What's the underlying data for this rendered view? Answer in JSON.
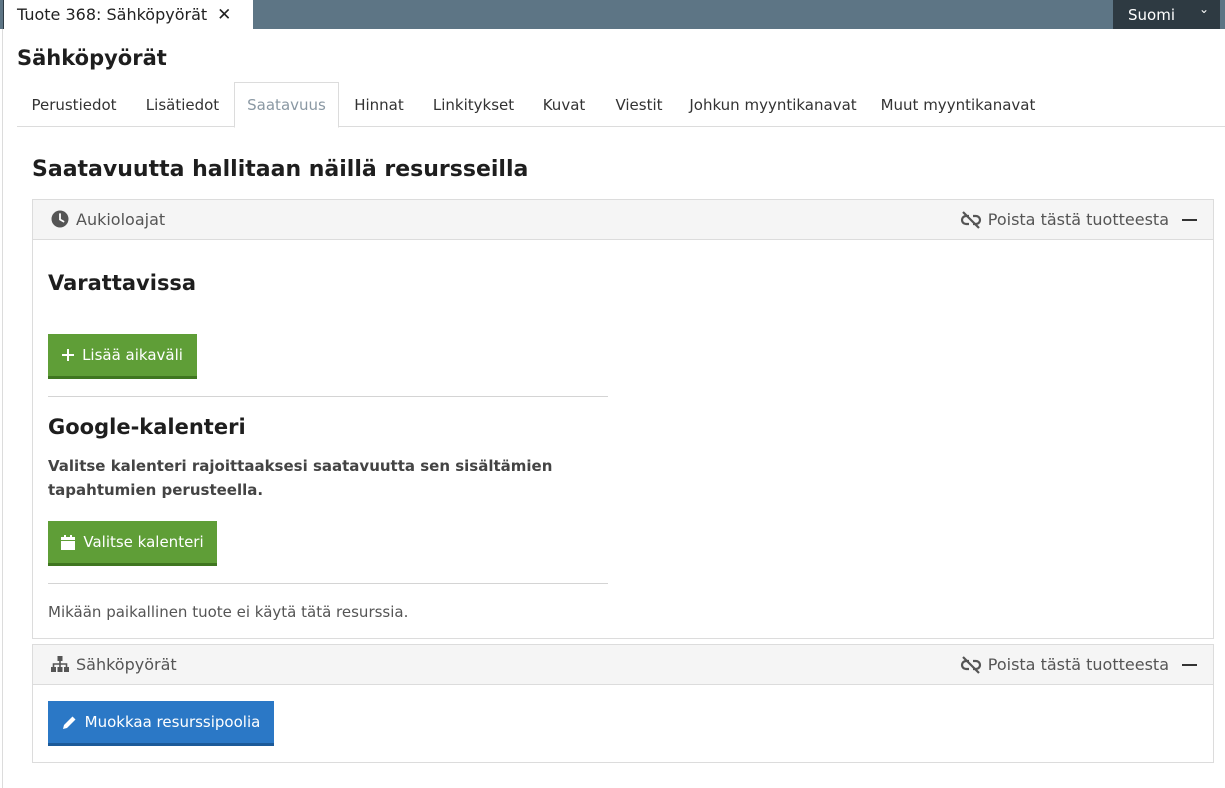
{
  "topbar": {
    "doc_tab_label": "Tuote 368: Sähköpyörät",
    "language": "Suomi"
  },
  "page": {
    "title": "Sähköpyörät",
    "section_title": "Saatavuutta hallitaan näillä resursseilla"
  },
  "tabs": [
    {
      "label": "Perustiedot"
    },
    {
      "label": "Lisätiedot"
    },
    {
      "label": "Saatavuus"
    },
    {
      "label": "Hinnat"
    },
    {
      "label": "Linkitykset"
    },
    {
      "label": "Kuvat"
    },
    {
      "label": "Viestit"
    },
    {
      "label": "Johkun myyntikanavat"
    },
    {
      "label": "Muut myyntikanavat"
    }
  ],
  "active_tab": "Saatavuus",
  "panels": {
    "opening_hours": {
      "title": "Aukioloajat",
      "remove_label": "Poista tästä tuotteesta",
      "bookable_heading": "Varattavissa",
      "add_interval_label": "Lisää aikaväli",
      "google_heading": "Google-kalenteri",
      "google_description": "Valitse kalenteri rajoittaaksesi saatavuutta sen sisältämien tapahtumien perusteella.",
      "choose_calendar_label": "Valitse kalenteri",
      "note": "Mikään paikallinen tuote ei käytä tätä resurssia."
    },
    "pool": {
      "title": "Sähköpyörät",
      "remove_label": "Poista tästä tuotteesta",
      "edit_pool_label": "Muokkaa resurssipoolia"
    }
  },
  "colors": {
    "topbar": "#5d7585",
    "language_bg": "#2e3a42",
    "green_button": "#5f9e37",
    "blue_button": "#2b78c6",
    "active_tab_text": "#8a98a3"
  }
}
